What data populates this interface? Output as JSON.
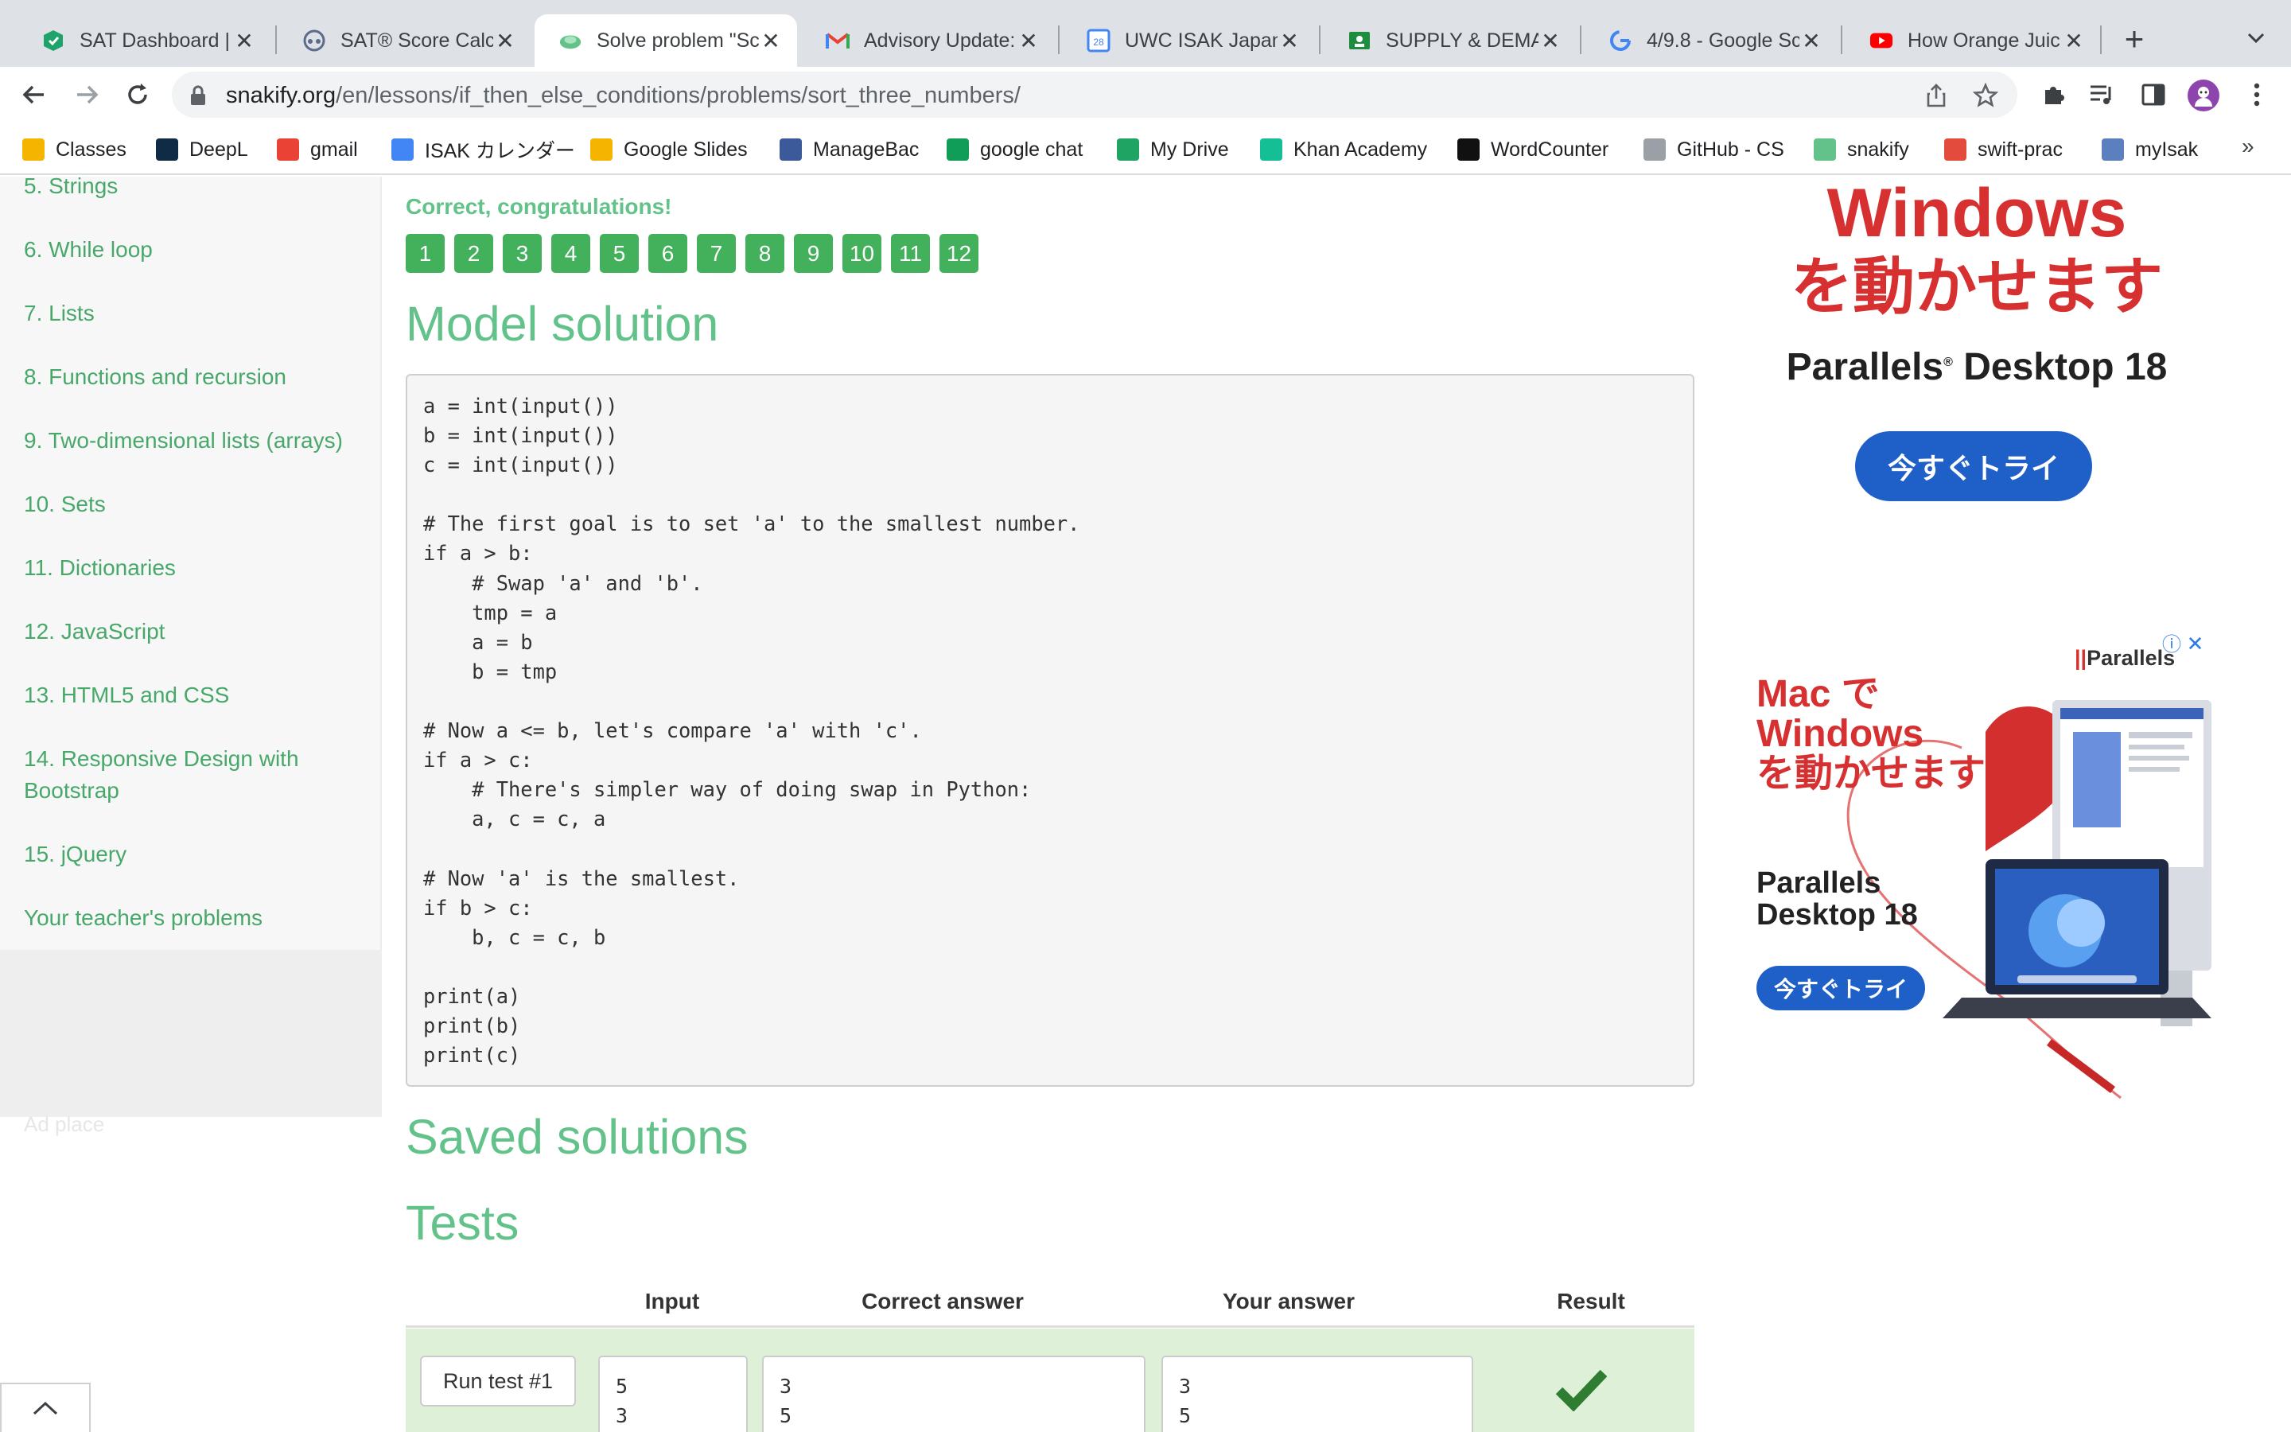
{
  "browser": {
    "tabs": [
      {
        "title": "SAT Dashboard | I",
        "icon": "sat-dashboard-icon"
      },
      {
        "title": "SAT® Score Calcu",
        "icon": "sat-score-icon"
      },
      {
        "title": "Solve problem \"Sc",
        "icon": "snakify-icon",
        "active": true
      },
      {
        "title": "Advisory Update:",
        "icon": "gmail-icon"
      },
      {
        "title": "UWC ISAK Japan",
        "icon": "calendar-icon"
      },
      {
        "title": "SUPPLY & DEMAI",
        "icon": "classroom-icon"
      },
      {
        "title": "4/9.8 - Google Sc",
        "icon": "google-icon"
      },
      {
        "title": "How Orange Juic",
        "icon": "youtube-icon"
      }
    ],
    "url_host": "snakify.org",
    "url_path": "/en/lessons/if_then_else_conditions/problems/sort_three_numbers/",
    "bookmarks": [
      {
        "label": "Classes",
        "icon": "classroom-icon",
        "color": "#f4b400"
      },
      {
        "label": "DeepL",
        "icon": "deepl-icon",
        "color": "#0f2b46"
      },
      {
        "label": "gmail",
        "icon": "gmail-icon",
        "color": "#ea4335"
      },
      {
        "label": "ISAK カレンダー",
        "icon": "calendar-icon",
        "color": "#4285f4"
      },
      {
        "label": "Google Slides",
        "icon": "slides-icon",
        "color": "#f4b400"
      },
      {
        "label": "ManageBac",
        "icon": "managebac-icon",
        "color": "#3c5a99"
      },
      {
        "label": "google chat",
        "icon": "chat-icon",
        "color": "#0f9d58"
      },
      {
        "label": "My Drive",
        "icon": "drive-icon",
        "color": "#1fa463"
      },
      {
        "label": "Khan Academy",
        "icon": "khan-icon",
        "color": "#14bf96"
      },
      {
        "label": "WordCounter",
        "icon": "wordcounter-icon",
        "color": "#111111"
      },
      {
        "label": "GitHub - CS",
        "icon": "github-icon",
        "color": "#9aa0a6"
      },
      {
        "label": "snakify",
        "icon": "snakify-icon",
        "color": "#63c28a"
      },
      {
        "label": "swift-prac",
        "icon": "swift-icon",
        "color": "#e34b3c"
      },
      {
        "label": "myIsak",
        "icon": "isak-icon",
        "color": "#5b7fbf"
      }
    ]
  },
  "sidebar": {
    "items": [
      "5. Strings",
      "6. While loop",
      "7. Lists",
      "8. Functions and recursion",
      "9. Two-dimensional lists (arrays)",
      "10. Sets",
      "11. Dictionaries",
      "12. JavaScript",
      "13. HTML5 and CSS",
      "14. Responsive Design with Bootstrap",
      "15. jQuery",
      "Your teacher's problems"
    ],
    "ad_place": "Ad place"
  },
  "main": {
    "congrats": "Correct, congratulations!",
    "test_numbers": [
      "1",
      "2",
      "3",
      "4",
      "5",
      "6",
      "7",
      "8",
      "9",
      "10",
      "11",
      "12"
    ],
    "model_solution_heading": "Model solution",
    "code": "a = int(input())\nb = int(input())\nc = int(input())\n\n# The first goal is to set 'a' to the smallest number.\nif a > b:\n    # Swap 'a' and 'b'.\n    tmp = a\n    a = b\n    b = tmp\n\n# Now a <= b, let's compare 'a' with 'c'.\nif a > c:\n    # There's simpler way of doing swap in Python:\n    a, c = c, a\n\n# Now 'a' is the smallest.\nif b > c:\n    b, c = c, b\n\nprint(a)\nprint(b)\nprint(c)",
    "saved_solutions_heading": "Saved solutions",
    "tests_heading": "Tests",
    "tests_columns": [
      "Input",
      "Correct answer",
      "Your answer",
      "Result"
    ],
    "tests": [
      {
        "run_label": "Run test #1",
        "input": "5\n3",
        "correct": "3\n5",
        "yours": "3\n5",
        "result": "passed"
      }
    ]
  },
  "ads": {
    "ad1_title_line1": "Windows",
    "ad1_title_line2": "を動かせます",
    "ad1_brand": "Parallels",
    "ad1_brand_suffix": "Desktop 18",
    "ad1_button": "今すぐトライ",
    "ad2_logo": "Parallels",
    "ad2_title": "Mac で\nWindows\nを動かせます",
    "ad2_brand": "Parallels\nDesktop 18",
    "ad2_button": "今すぐトライ",
    "accent": "#d63031",
    "button_color": "#1f5fc8"
  },
  "colors": {
    "snakify_green": "#63c28a",
    "badge_green": "#43b05c",
    "test_row_bg": "#dff0d8",
    "check_green": "#2e7d32"
  }
}
